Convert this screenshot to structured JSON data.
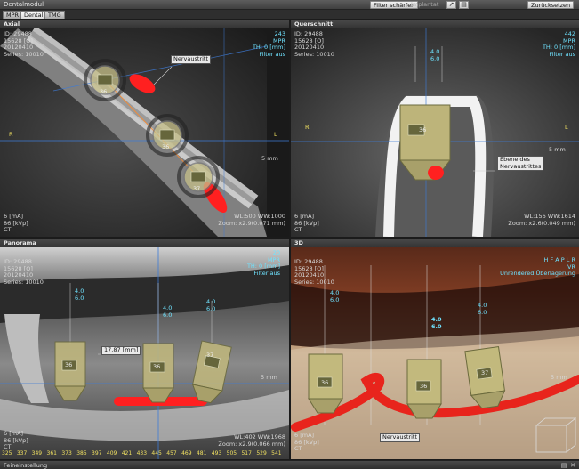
{
  "app": {
    "title": "Dentalmodul",
    "filter_sharpen": "Filter schärfen",
    "implant_label": "Implantat",
    "reset_label": "Zurücksetzen"
  },
  "tabs": [
    {
      "label": "MPR",
      "active": false
    },
    {
      "label": "Dental",
      "active": true
    },
    {
      "label": "TMG",
      "active": false
    }
  ],
  "panels": {
    "axial": {
      "title": "Axial",
      "info": [
        "ID: 29488",
        "15628 [O]",
        "20120410",
        "Series: 10010"
      ],
      "top_right": {
        "slice": "243",
        "mode": "MPR",
        "thickness": "TH: 0 [mm]",
        "filter": "Filter aus"
      },
      "nerve_label": "Nervaustritt",
      "orientation_left": "R",
      "orientation_right": "L",
      "scale": "5 mm",
      "bottom_left": [
        "6 [mA]",
        "86 [kVp]",
        "CT"
      ],
      "window": "WL:500 WW:1000",
      "zoom": "Zoom: x2.9(0.071 mm)",
      "implants": [
        "36",
        "36",
        "37"
      ]
    },
    "cross": {
      "title": "Querschnitt",
      "info": [
        "ID: 29488",
        "15628 [O]",
        "20120410",
        "Series: 10010"
      ],
      "top_right": {
        "slice": "442",
        "mode": "MPR",
        "thickness": "TH: 0 [mm]",
        "filter": "Filter aus"
      },
      "dims": [
        "4.0",
        "6.0"
      ],
      "orientation_left": "R",
      "orientation_right": "L",
      "scale": "5 mm",
      "nerve_label_line1": "Ebene des",
      "nerve_label_line2": "Nervaustrittes",
      "bottom_left": [
        "6 [mA]",
        "86 [kVp]",
        "CT"
      ],
      "window": "WL:156 WW:1614",
      "zoom": "Zoom: x2.6(0.049 mm)",
      "implant": "36"
    },
    "panorama": {
      "title": "Panorama",
      "info": [
        "ID: 29488",
        "15628 [O]",
        "20120410",
        "Series: 10010"
      ],
      "top_right": {
        "slice": "20",
        "mode": "MPR",
        "thickness": "TH: 0 [mm]",
        "filter": "Filter aus"
      },
      "distance": "17.87 [mm]",
      "implants": [
        {
          "label": "36",
          "d1": "4.0",
          "d2": "6.0"
        },
        {
          "label": "36",
          "d1": "4.0",
          "d2": "6.0"
        },
        {
          "label": "37",
          "d1": "4.0",
          "d2": "6.0"
        }
      ],
      "scale": "5 mm",
      "bottom_left": [
        "6 [mA]",
        "86 [kVp]",
        "CT"
      ],
      "window": "WL:402 WW:1968",
      "zoom": "Zoom: x2.9(0.066 mm)",
      "ruler": [
        "325",
        "337",
        "349",
        "361",
        "373",
        "385",
        "397",
        "409",
        "421",
        "433",
        "445",
        "457",
        "469",
        "481",
        "493",
        "505",
        "517",
        "529",
        "541"
      ]
    },
    "threed": {
      "title": "3D",
      "info": [
        "ID: 29488",
        "15628 [O]",
        "20120410",
        "Series: 10010"
      ],
      "top_right": {
        "orient": "H F A P L R",
        "mode": "VR",
        "filter": "Unrendered Überlagerung"
      },
      "implants": [
        {
          "label": "36",
          "d1": "4.0",
          "d2": "6.0"
        },
        {
          "label": "36",
          "d1": "4.0",
          "d2": "6.0"
        },
        {
          "label": "37",
          "d1": "4.0",
          "d2": "6.0"
        }
      ],
      "scale": "5 mm",
      "nerve_label": "Nervaustritt",
      "bottom_left": [
        "6 [mA]",
        "86 [kVp]",
        "CT"
      ]
    }
  },
  "status": {
    "label": "Feineinstellung"
  }
}
